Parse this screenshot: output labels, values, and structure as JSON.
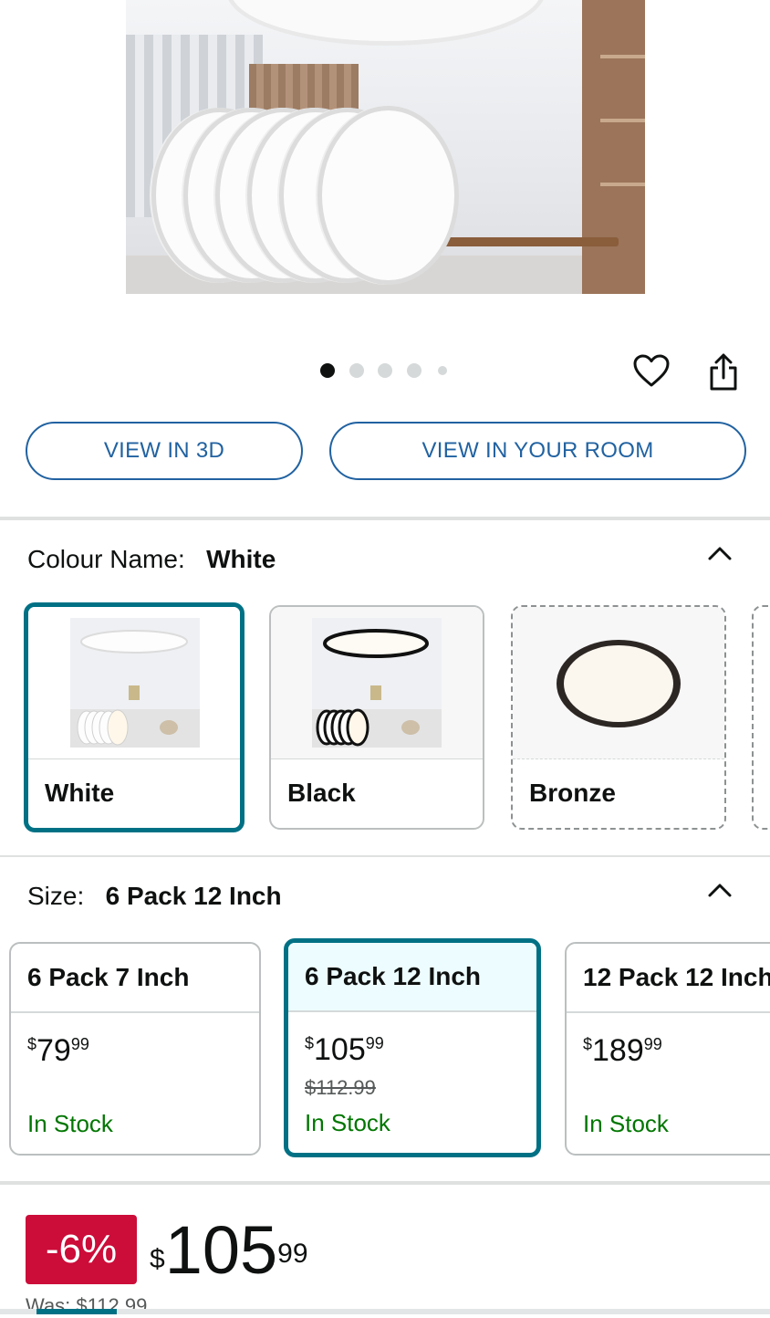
{
  "gallery": {
    "dot_count": 5,
    "active_index": 0,
    "wishlist_icon": "heart-icon",
    "share_icon": "share-icon"
  },
  "actions": {
    "view_3d": "VIEW IN 3D",
    "view_room": "VIEW IN YOUR ROOM"
  },
  "colour": {
    "label": "Colour Name:",
    "selected": "White",
    "options": [
      {
        "name": "White"
      },
      {
        "name": "Black"
      },
      {
        "name": "Bronze"
      }
    ]
  },
  "size": {
    "label": "Size:",
    "selected": "6 Pack 12 Inch",
    "options": [
      {
        "name": "6 Pack 7 Inch",
        "currency": "$",
        "whole": "79",
        "cents": "99",
        "was": "",
        "stock": "In Stock"
      },
      {
        "name": "6 Pack 12 Inch",
        "currency": "$",
        "whole": "105",
        "cents": "99",
        "was": "$112.99",
        "stock": "In Stock"
      },
      {
        "name": "12 Pack 12 Inch",
        "currency": "$",
        "whole": "189",
        "cents": "99",
        "was": "",
        "stock": "In Stock"
      }
    ]
  },
  "price": {
    "discount": "-6%",
    "currency": "$",
    "whole": "105",
    "cents": "99",
    "was": "Was: $112.99"
  },
  "colors": {
    "accent": "#007185",
    "link": "#2162a1",
    "deal": "#cc0c39",
    "in_stock": "#007600"
  }
}
